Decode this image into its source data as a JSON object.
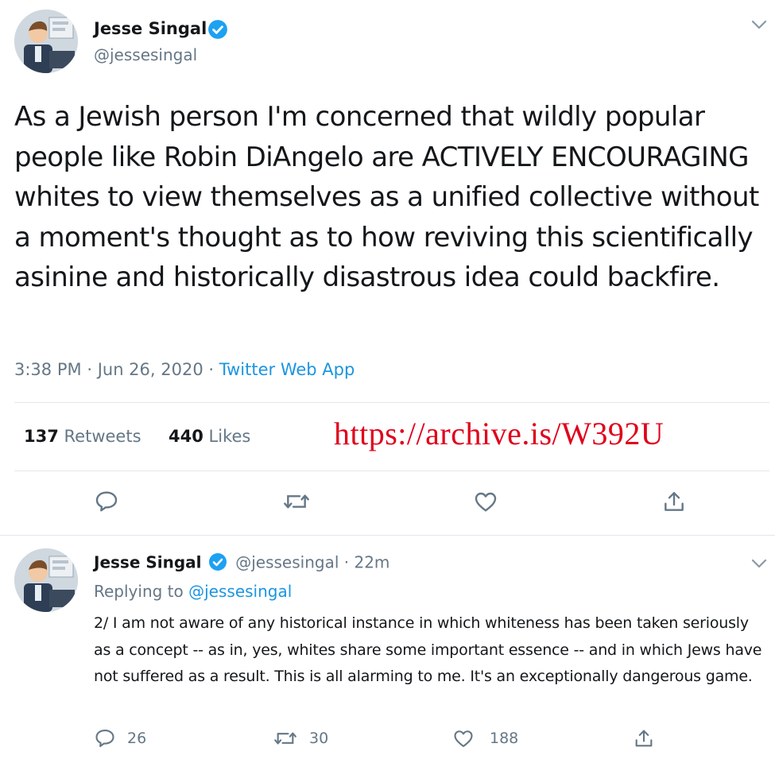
{
  "main_tweet": {
    "author": {
      "name": "Jesse Singal",
      "handle": "@jessesingal",
      "verified": true
    },
    "text": "As a Jewish person I'm concerned that wildly popular people like Robin DiAngelo are ACTIVELY ENCOURAGING whites to view themselves as a unified collective without a moment's thought as to how reviving this scientifically asinine and historically disastrous idea could backfire.",
    "meta": {
      "time": "3:38 PM",
      "sep1": "·",
      "date": "Jun 26, 2020",
      "sep2": "·",
      "client": "Twitter Web App"
    },
    "stats": {
      "retweets_count": "137",
      "retweets_label": "Retweets",
      "likes_count": "440",
      "likes_label": "Likes"
    },
    "archive_link": "https://archive.is/W392U",
    "actions": [
      "reply-icon",
      "retweet-icon",
      "like-icon",
      "share-icon"
    ]
  },
  "reply_tweet": {
    "author": {
      "name": "Jesse Singal",
      "handle": "@jessesingal",
      "dot": "·",
      "time": "22m",
      "verified": true
    },
    "replying_label": "Replying to",
    "replying_handle": "@jessesingal",
    "text": "2/ I am not aware of any historical instance in which whiteness has been taken seriously as a concept -- as in, yes, whites share some important essence -- and in which Jews have not suffered as a result. This is all alarming to me. It's an exceptionally dangerous game.",
    "actions": {
      "reply_count": "26",
      "retweet_count": "30",
      "like_count": "188"
    }
  },
  "colors": {
    "accent": "#1b95e0",
    "verified": "#1da1f2",
    "archive_link": "#e0001b",
    "muted": "#657786",
    "divider": "#e1e8ed"
  }
}
